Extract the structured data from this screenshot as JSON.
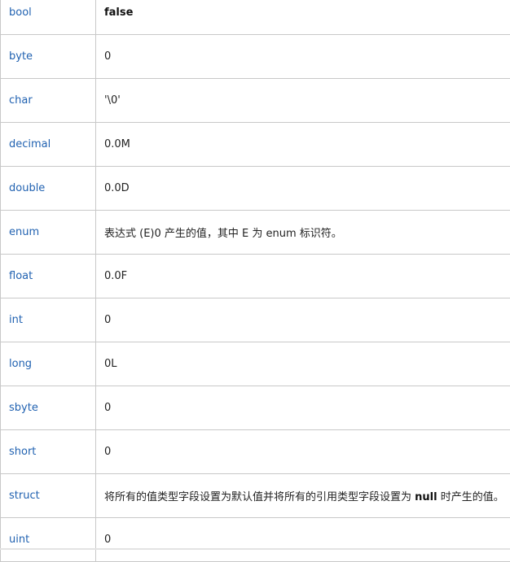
{
  "rows": [
    {
      "type": "bool",
      "value_pre": "",
      "value_bold": "false",
      "value_post": ""
    },
    {
      "type": "byte",
      "value_pre": "0",
      "value_bold": "",
      "value_post": ""
    },
    {
      "type": "char",
      "value_pre": "'\\0'",
      "value_bold": "",
      "value_post": ""
    },
    {
      "type": "decimal",
      "value_pre": "0.0M",
      "value_bold": "",
      "value_post": ""
    },
    {
      "type": "double",
      "value_pre": "0.0D",
      "value_bold": "",
      "value_post": ""
    },
    {
      "type": "enum",
      "value_pre": "表达式 (E)0 产生的值，其中 E 为 enum 标识符。",
      "value_bold": "",
      "value_post": ""
    },
    {
      "type": "float",
      "value_pre": "0.0F",
      "value_bold": "",
      "value_post": ""
    },
    {
      "type": "int",
      "value_pre": "0",
      "value_bold": "",
      "value_post": ""
    },
    {
      "type": "long",
      "value_pre": "0L",
      "value_bold": "",
      "value_post": ""
    },
    {
      "type": "sbyte",
      "value_pre": "0",
      "value_bold": "",
      "value_post": ""
    },
    {
      "type": "short",
      "value_pre": "0",
      "value_bold": "",
      "value_post": ""
    },
    {
      "type": "struct",
      "value_pre": "将所有的值类型字段设置为默认值并将所有的引用类型字段设置为 ",
      "value_bold": "null",
      "value_post": " 时产生的值。"
    },
    {
      "type": "uint",
      "value_pre": "0",
      "value_bold": "",
      "value_post": ""
    }
  ]
}
